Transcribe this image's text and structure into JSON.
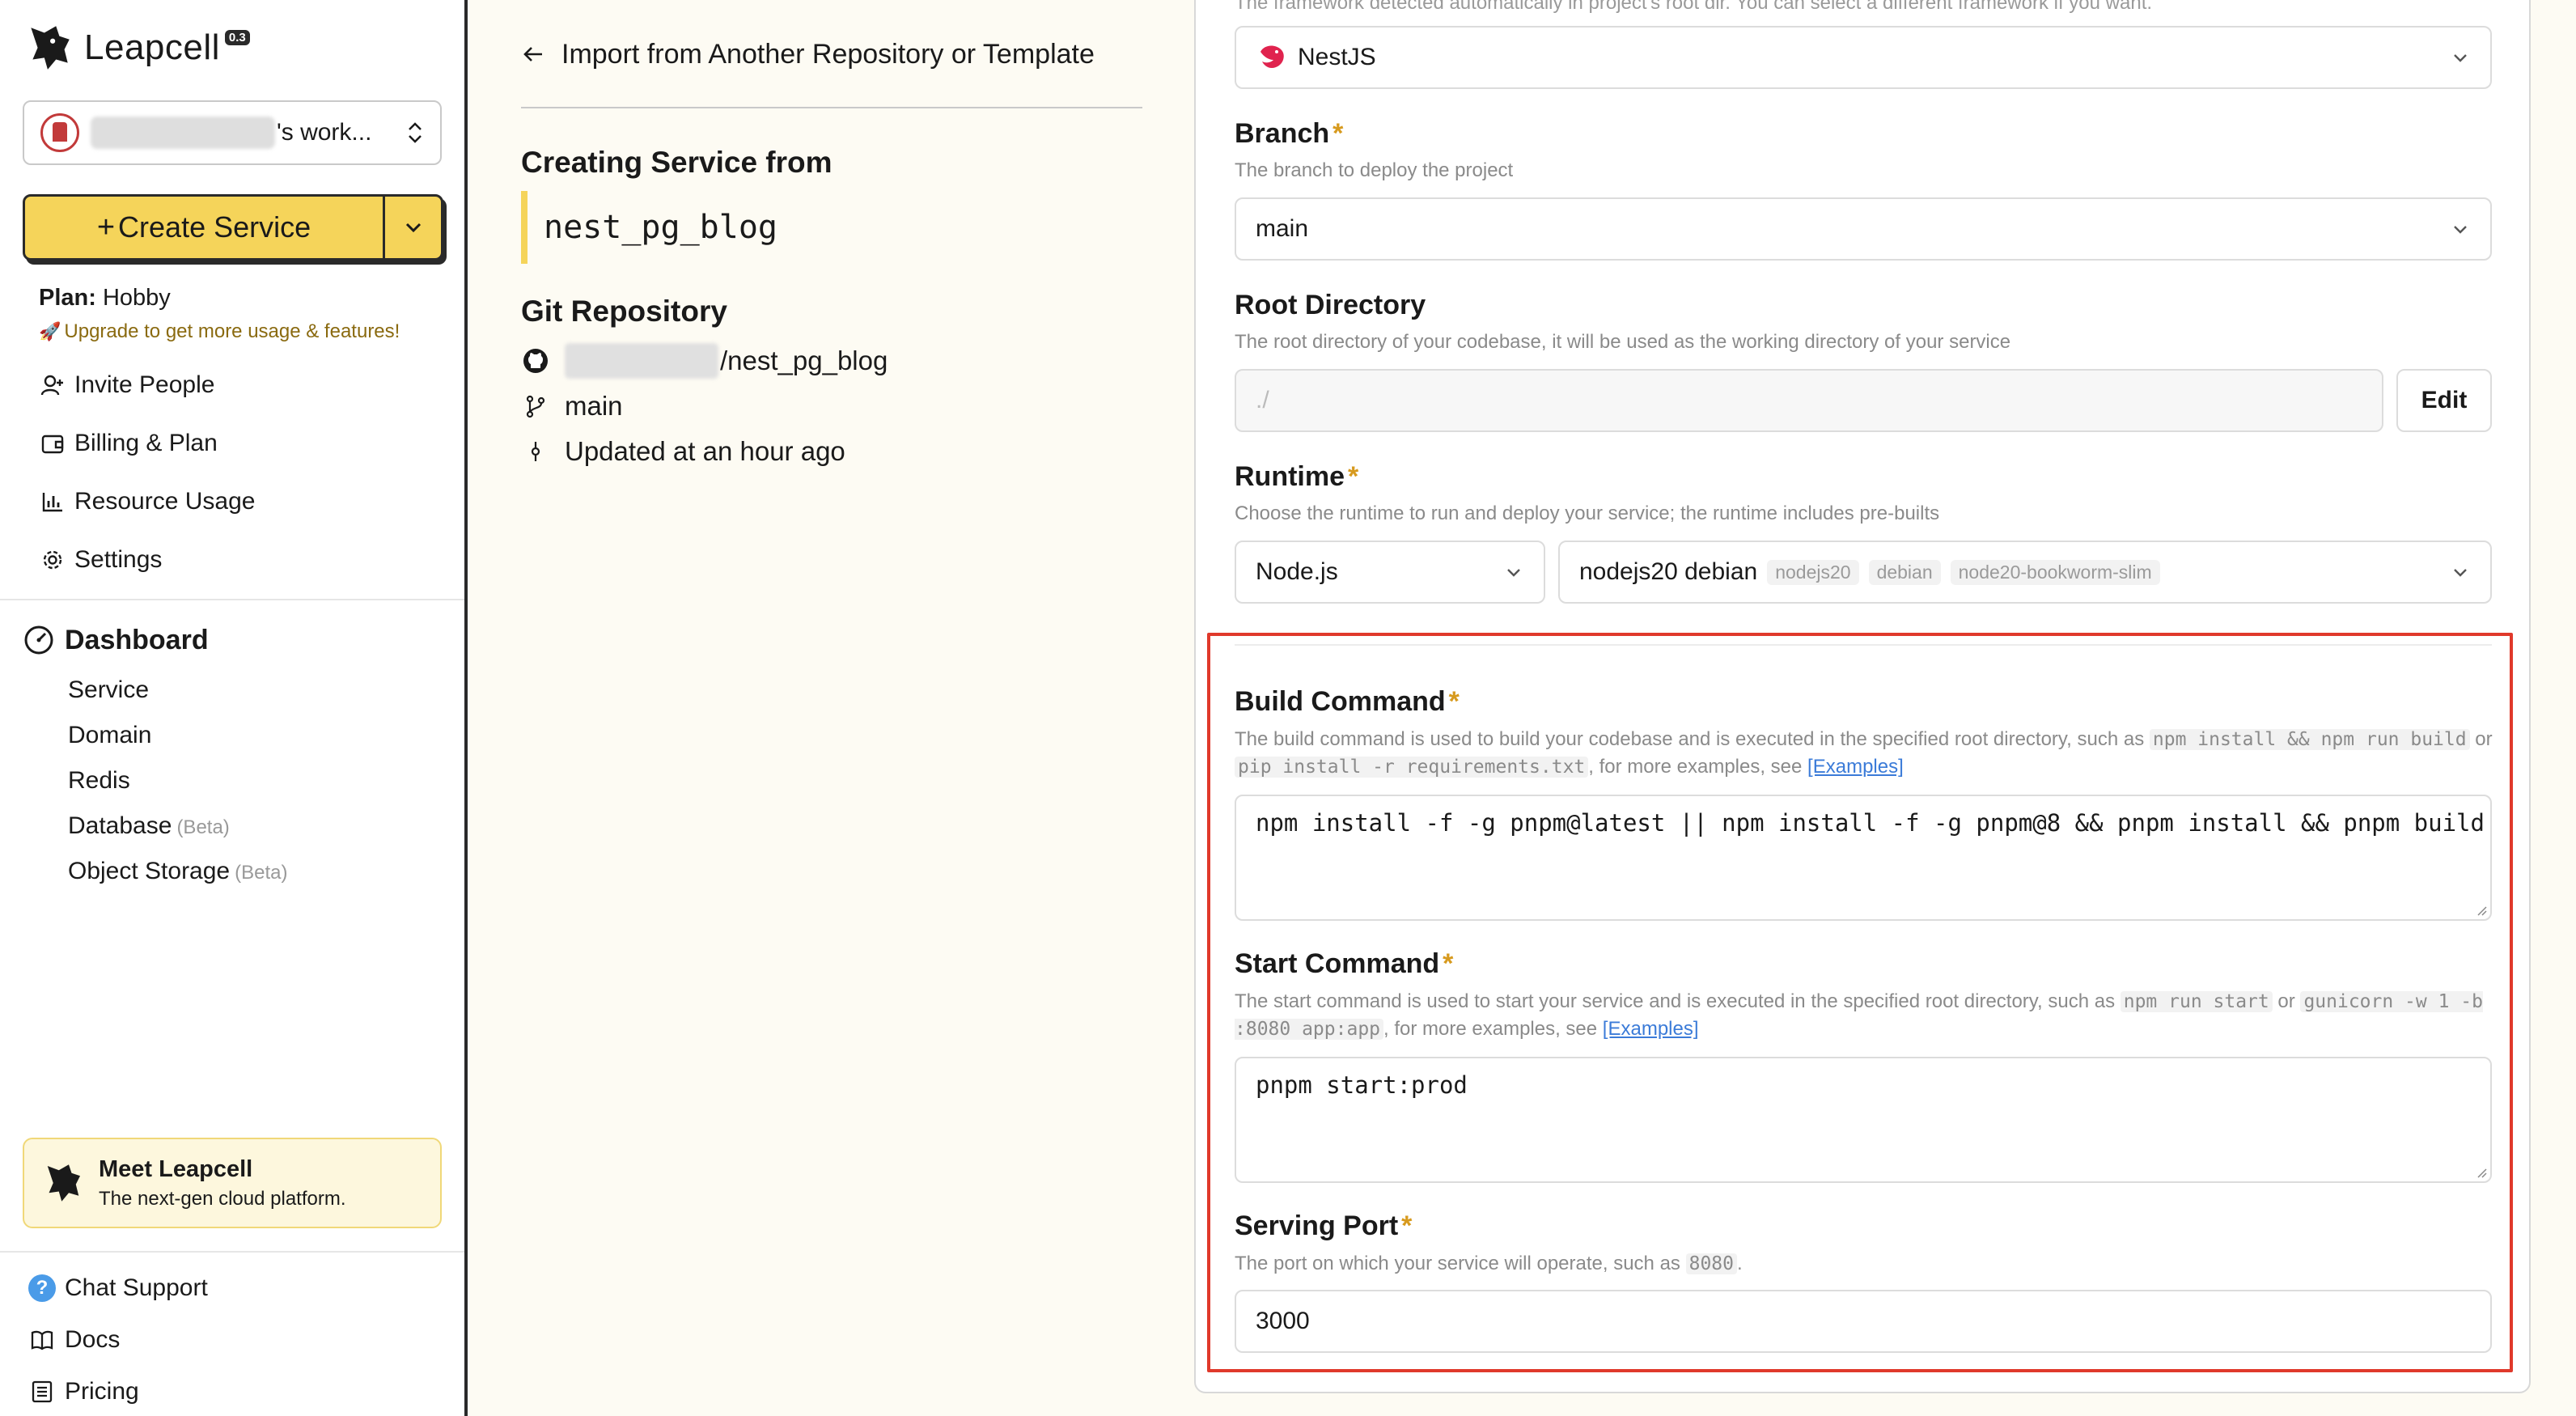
{
  "sidebar": {
    "brand": "Leapcell",
    "version_badge": "0.3",
    "workspace_suffix": "'s work...",
    "create_button": "Create Service",
    "plan_label": "Plan:",
    "plan_value": "Hobby",
    "upgrade_text": "Upgrade to get more usage & features!",
    "nav": [
      {
        "label": "Invite People",
        "icon": "user-plus-icon"
      },
      {
        "label": "Billing & Plan",
        "icon": "wallet-icon"
      },
      {
        "label": "Resource Usage",
        "icon": "bar-chart-icon"
      },
      {
        "label": "Settings",
        "icon": "gear-icon"
      }
    ],
    "dashboard": {
      "title": "Dashboard",
      "items": [
        {
          "label": "Service",
          "beta": ""
        },
        {
          "label": "Domain",
          "beta": ""
        },
        {
          "label": "Redis",
          "beta": ""
        },
        {
          "label": "Database",
          "beta": "(Beta)"
        },
        {
          "label": "Object Storage",
          "beta": "(Beta)"
        }
      ]
    },
    "promo": {
      "title": "Meet Leapcell",
      "subtitle": "The next-gen cloud platform."
    },
    "footer": [
      {
        "label": "Chat Support",
        "icon": "chat-support-icon"
      },
      {
        "label": "Docs",
        "icon": "book-icon"
      },
      {
        "label": "Pricing",
        "icon": "list-icon"
      }
    ]
  },
  "middle": {
    "back_label": "Import from Another Repository or Template",
    "creating_heading": "Creating Service from",
    "service_name": "nest_pg_blog",
    "git_heading": "Git Repository",
    "repo_suffix": "/nest_pg_blog",
    "branch": "main",
    "updated": "Updated at an hour ago"
  },
  "form": {
    "top_note": "The framework detected automatically in project's root dir. You can select a different framework if you want.",
    "framework": "NestJS",
    "branch": {
      "label": "Branch",
      "hint": "The branch to deploy the project",
      "value": "main"
    },
    "root_dir": {
      "label": "Root Directory",
      "hint": "The root directory of your codebase, it will be used as the working directory of your service",
      "placeholder": "./",
      "edit_label": "Edit"
    },
    "runtime": {
      "label": "Runtime",
      "hint": "Choose the runtime to run and deploy your service; the runtime includes pre-builts",
      "language": "Node.js",
      "image": "nodejs20 debian",
      "tags": [
        "nodejs20",
        "debian",
        "node20-bookworm-slim"
      ]
    },
    "build": {
      "label": "Build Command",
      "hint_a": "The build command is used to build your codebase and is executed in the specified root directory, such as",
      "code_a": "npm install && npm run build",
      "hint_or": "or",
      "code_b": "pip install -r requirements.txt",
      "hint_b": ", for more examples, see",
      "link": "[Examples]",
      "value": "npm install -f -g pnpm@latest || npm install -f -g pnpm@8 && pnpm install && pnpm build"
    },
    "start": {
      "label": "Start Command",
      "hint_a": "The start command is used to start your service and is executed in the specified root directory, such as",
      "code_a": "npm run start",
      "hint_or": "or",
      "code_b": "gunicorn -w 1 -b :8080 app:app",
      "hint_b": ", for more examples, see",
      "link": "[Examples]",
      "value": "pnpm start:prod"
    },
    "port": {
      "label": "Serving Port",
      "hint_a": "The port on which your service will operate, such as",
      "code_a": "8080",
      "hint_end": ".",
      "value": "3000"
    },
    "required_mark": "*"
  },
  "colors": {
    "accent_yellow": "#f5d45a",
    "required": "#d79a1e",
    "highlight_border": "#e0392b",
    "link": "#3b7bd8"
  }
}
